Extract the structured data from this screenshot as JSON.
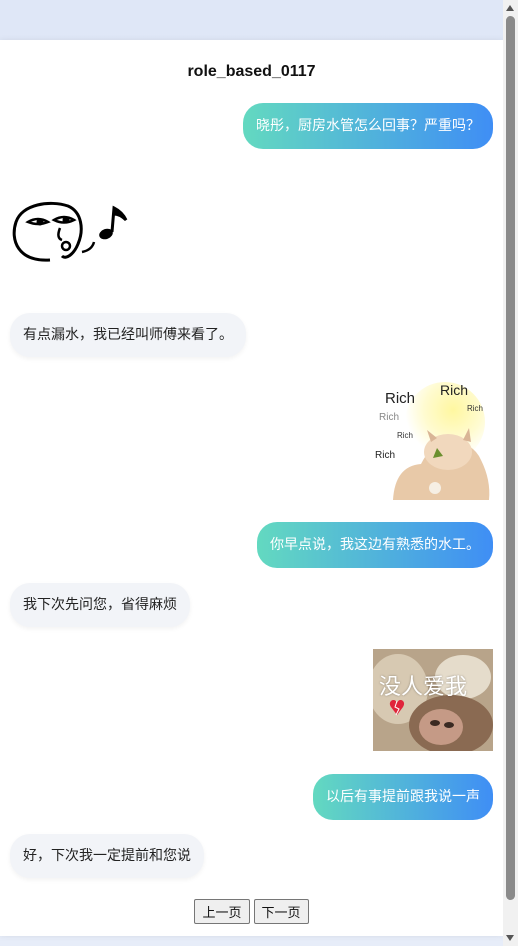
{
  "chat": {
    "title": "role_based_0117",
    "messages": [
      {
        "side": "right",
        "type": "text",
        "text": "晓彤，厨房水管怎么回事？严重吗？"
      },
      {
        "side": "left",
        "type": "sticker",
        "sticker": "whistling-face-icon"
      },
      {
        "side": "left",
        "type": "text",
        "text": "有点漏水，我已经叫师傅来看了。"
      },
      {
        "side": "right",
        "type": "image",
        "image": "rich-cat-meme",
        "caption": [
          "Rich",
          "Rich",
          "Rich",
          "Rich",
          "Rich",
          "Rich"
        ]
      },
      {
        "side": "right",
        "type": "text",
        "text": "你早点说，我这边有熟悉的水工。"
      },
      {
        "side": "left",
        "type": "text",
        "text": "我下次先问您，省得麻烦"
      },
      {
        "side": "right",
        "type": "image",
        "image": "sad-monkey-meme",
        "caption": [
          "没人爱我"
        ]
      },
      {
        "side": "right",
        "type": "text",
        "text": "以后有事提前跟我说一声"
      },
      {
        "side": "left",
        "type": "text",
        "text": "好，下次我一定提前和您说"
      }
    ]
  },
  "pager": {
    "prev_label": "上一页",
    "next_label": "下一页"
  },
  "colors": {
    "bubble_right_start": "#63d9c0",
    "bubble_right_end": "#3f8ef5",
    "bubble_left": "#f2f4f8"
  }
}
